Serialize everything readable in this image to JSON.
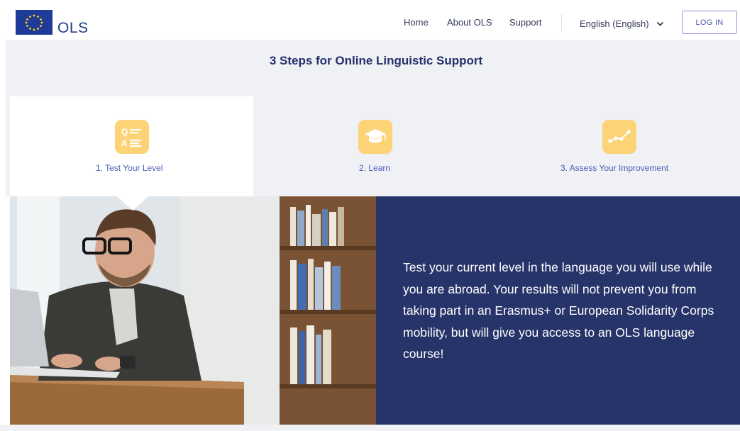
{
  "header": {
    "logo_text": "OLS",
    "nav": {
      "home": "Home",
      "about": "About OLS",
      "support": "Support"
    },
    "language": "English (English)",
    "login_label": "LOG IN"
  },
  "steps": {
    "title": "3 Steps for Online Linguistic Support",
    "items": [
      {
        "label": "1. Test Your Level",
        "icon": "qa-icon",
        "active": true
      },
      {
        "label": "2. Learn",
        "icon": "graduation-cap-icon",
        "active": false
      },
      {
        "label": "3. Assess Your Improvement",
        "icon": "progress-chart-icon",
        "active": false
      }
    ]
  },
  "content": {
    "description": "Test your current level in the language you will use while you are abroad. Your results will not prevent you from taking part in an Erasmus+ or European Solidarity Corps mobility, but will give you access to an OLS language course!"
  },
  "colors": {
    "navy": "#27346a",
    "accent_yellow": "#fdd378",
    "link_blue": "#4d5bb9",
    "eu_blue": "#1f3b9a",
    "eu_star": "#ffd700"
  }
}
